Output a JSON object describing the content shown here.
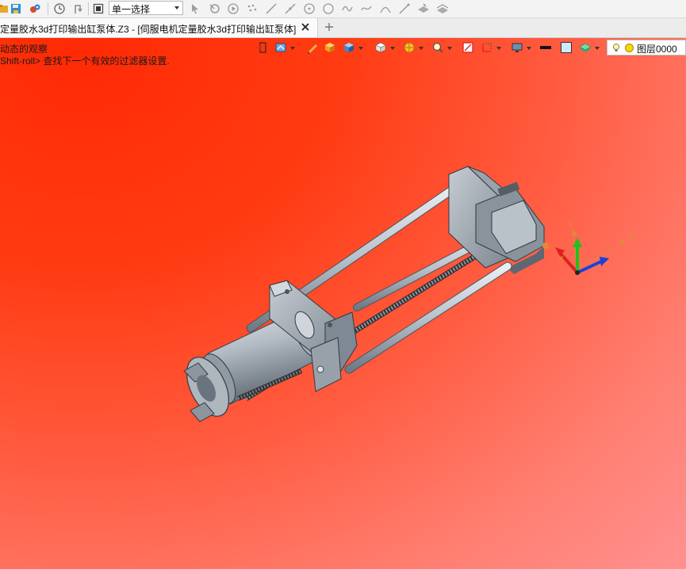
{
  "toolbar": {
    "select_filter": "单一选择"
  },
  "tabs": {
    "document_title": "定量胶水3d打印输出缸泵体.Z3 - [伺服电机定量胶水3d打印输出缸泵体]",
    "add_tab_label": "+"
  },
  "viewport": {
    "hint_line1": "动态的观察",
    "hint_line2": "Shift-roll> 查找下一个有效的过滤器设置."
  },
  "layer": {
    "name": "图层0000"
  },
  "triad": {
    "x": "X",
    "y": "Y",
    "z": "Z"
  },
  "colors": {
    "bg_top": "#ff2a05",
    "bg_bottom": "#ff9190",
    "axis_x": "#e02020",
    "axis_y": "#1fc21f",
    "axis_z": "#1e3fe0"
  }
}
